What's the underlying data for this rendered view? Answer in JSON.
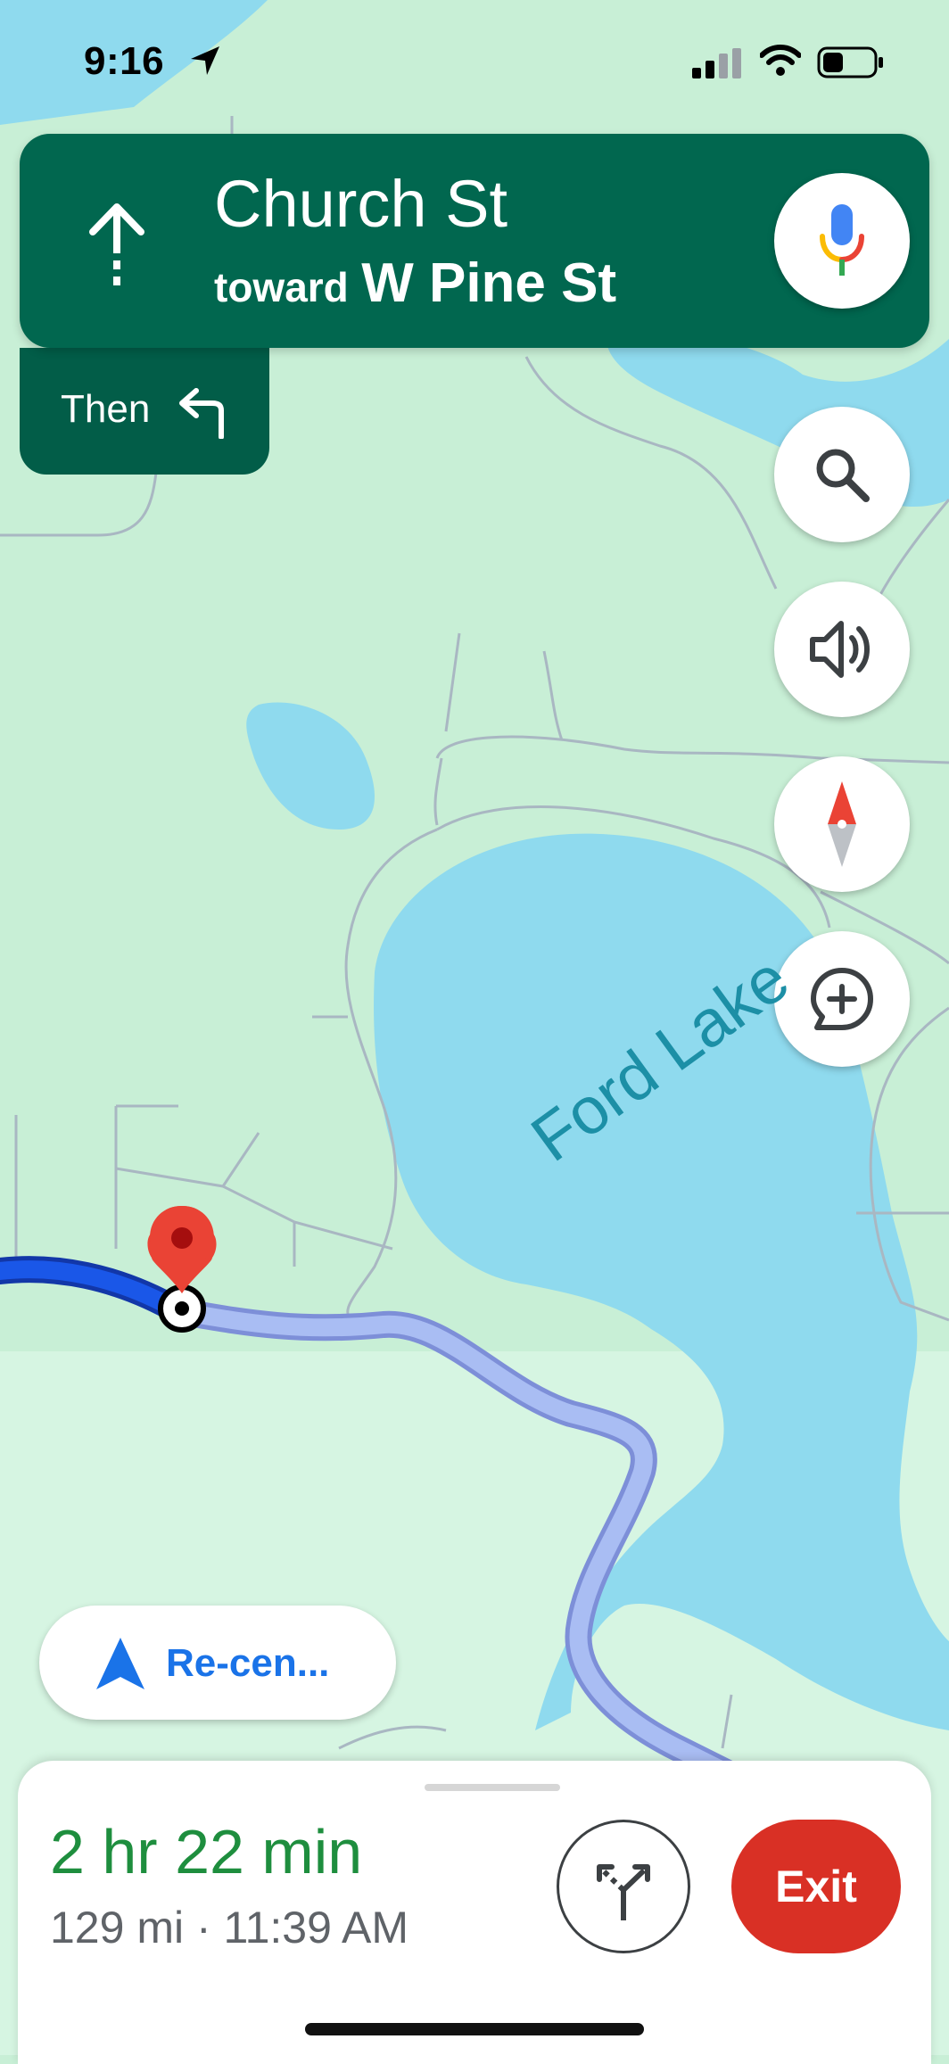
{
  "status_bar": {
    "time": "9:16",
    "icons": [
      "location-arrow-icon",
      "cellular-signal-icon",
      "wifi-icon",
      "battery-icon"
    ]
  },
  "navigation": {
    "maneuver_icon": "straight-arrow-icon",
    "street": "Church St",
    "toward_label": "toward",
    "toward_street": "W Pine St",
    "then_label": "Then",
    "then_icon": "turn-left-icon"
  },
  "map": {
    "lake_label": "Ford Lake",
    "colors": {
      "land": "#c8efd6",
      "water": "#8fdaee",
      "road": "#a9b7c2",
      "route_active": "#1a57e8",
      "route_ahead": "#a9bdf3",
      "pin": "#ea4335"
    }
  },
  "buttons": {
    "voice_search_icon": "microphone-icon",
    "search_icon": "search-icon",
    "sound_icon": "speaker-icon",
    "compass_icon": "compass-icon",
    "report_icon": "add-report-icon",
    "recenter_label": "Re-cen...",
    "recenter_icon": "navigation-arrow-icon"
  },
  "trip": {
    "duration": "2 hr 22 min",
    "details": "129 mi · 11:39 AM",
    "routes_icon": "alternate-routes-icon",
    "exit_label": "Exit"
  },
  "colors": {
    "banner": "#01674f",
    "then_panel": "#025d48",
    "eta_green": "#1e8e3e",
    "exit_red": "#d93025",
    "recenter_blue": "#1a73e8"
  }
}
